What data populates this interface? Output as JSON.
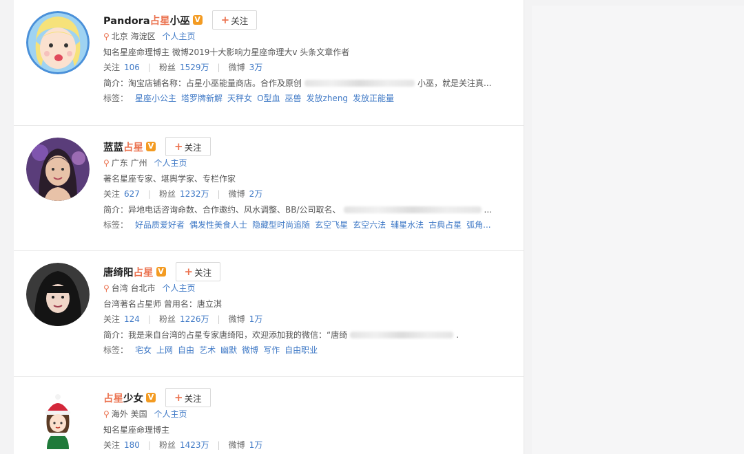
{
  "follow_label": "+关注",
  "plus_glyph": "+",
  "follow_text": "关注",
  "home_label": "个人主页",
  "labels": {
    "following": "关注",
    "fans": "粉丝",
    "weibo": "微博",
    "intro": "简介：",
    "tags": "标签："
  },
  "colors": {
    "accent": "#eb7350",
    "link": "#3f79c6",
    "verified": "#f39b22"
  },
  "users": [
    {
      "name_plain": "Pandora",
      "name_highlight": "占星",
      "name_rest": "小巫",
      "location": "北京 海淀区",
      "description": "知名星座命理博主 微博2019十大影响力星座命理大v 头条文章作者",
      "following": "106",
      "fans": "1529万",
      "weibo": "3万",
      "intro_a": "淘宝店铺名称：占星小巫能量商店。合作及原创",
      "intro_b": "小巫，就是关注真...",
      "tags": [
        "星座小公主",
        "塔罗牌新解",
        "天秤女",
        "O型血",
        "巫兽",
        "发放zheng",
        "发放正能量"
      ]
    },
    {
      "name_plain": "蓝蓝",
      "name_highlight": "占星",
      "name_rest": "",
      "location": "广东 广州",
      "description": "著名星座专家、堪舆学家、专栏作家",
      "following": "627",
      "fans": "1232万",
      "weibo": "2万",
      "intro_a": "异地电话咨询命数、合作邀约、风水调整、BB/公司取名、",
      "intro_b": "...",
      "tags": [
        "好品质爱好者",
        "偶发性美食人士",
        "隐藏型时尚追随",
        "玄空飞星",
        "玄空六法",
        "辅星水法",
        "古典占星",
        "弧角..."
      ]
    },
    {
      "name_plain": "唐绮阳",
      "name_highlight": "占星",
      "name_rest": "",
      "location": "台湾 台北市",
      "description": "台湾著名占星师 曾用名：唐立淇",
      "following": "124",
      "fans": "1226万",
      "weibo": "1万",
      "intro_a": "我是来自台湾的占星专家唐绮阳，欢迎添加我的微信：“唐绮",
      "intro_b": ".",
      "tags": [
        "宅女",
        "上网",
        "自由",
        "艺术",
        "幽默",
        "微博",
        "写作",
        "自由职业"
      ]
    },
    {
      "name_plain": "",
      "name_highlight": "占星",
      "name_rest": "少女",
      "location": "海外 美国",
      "description": "知名星座命理博主",
      "following": "180",
      "fans": "1423万",
      "weibo": "1万"
    }
  ]
}
